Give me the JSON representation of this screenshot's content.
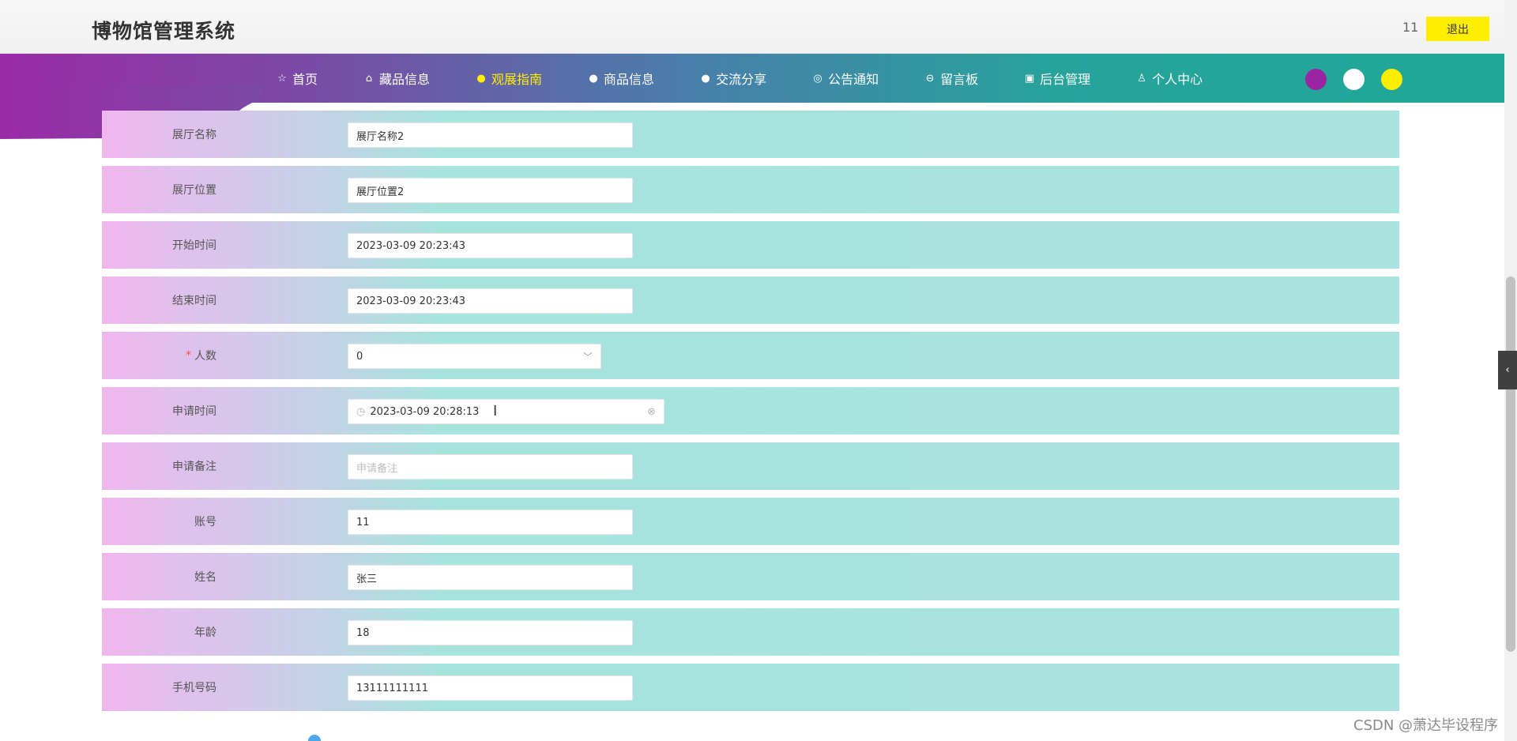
{
  "header": {
    "site_title": "博物馆管理系统",
    "user_name": "11",
    "logout_label": "退出"
  },
  "nav": {
    "items": [
      {
        "label": "首页",
        "icon": "star-icon",
        "active": false
      },
      {
        "label": "藏品信息",
        "icon": "bag-icon",
        "active": false
      },
      {
        "label": "观展指南",
        "icon": "info-circle-icon",
        "active": true
      },
      {
        "label": "商品信息",
        "icon": "help-circle-icon",
        "active": false
      },
      {
        "label": "交流分享",
        "icon": "info-circle-icon",
        "active": false
      },
      {
        "label": "公告通知",
        "icon": "at-icon",
        "active": false
      },
      {
        "label": "留言板",
        "icon": "minus-circle-icon",
        "active": false
      },
      {
        "label": "后台管理",
        "icon": "calendar-icon",
        "active": false
      },
      {
        "label": "个人中心",
        "icon": "user-icon",
        "active": false
      }
    ],
    "active_color": "#ffee00",
    "theme_colors": [
      "#9b24a3",
      "#ffffff",
      "#ffee00"
    ]
  },
  "form": {
    "hall_name": {
      "label": "展厅名称",
      "value": "展厅名称2"
    },
    "hall_location": {
      "label": "展厅位置",
      "value": "展厅位置2"
    },
    "start_time": {
      "label": "开始时间",
      "value": "2023-03-09 20:23:43"
    },
    "end_time": {
      "label": "结束时间",
      "value": "2023-03-09 20:23:43"
    },
    "people_count": {
      "label": "人数",
      "required_mark": "*",
      "value": "0"
    },
    "apply_time": {
      "label": "申请时间",
      "value": "2023-03-09 20:28:13"
    },
    "apply_note": {
      "label": "申请备注",
      "placeholder": "申请备注"
    },
    "account": {
      "label": "账号",
      "value": "11"
    },
    "name": {
      "label": "姓名",
      "value": "张三"
    },
    "age": {
      "label": "年龄",
      "value": "18"
    },
    "phone": {
      "label": "手机号码",
      "value": "13111111111"
    }
  },
  "watermark": "CSDN @萧达毕设程序"
}
